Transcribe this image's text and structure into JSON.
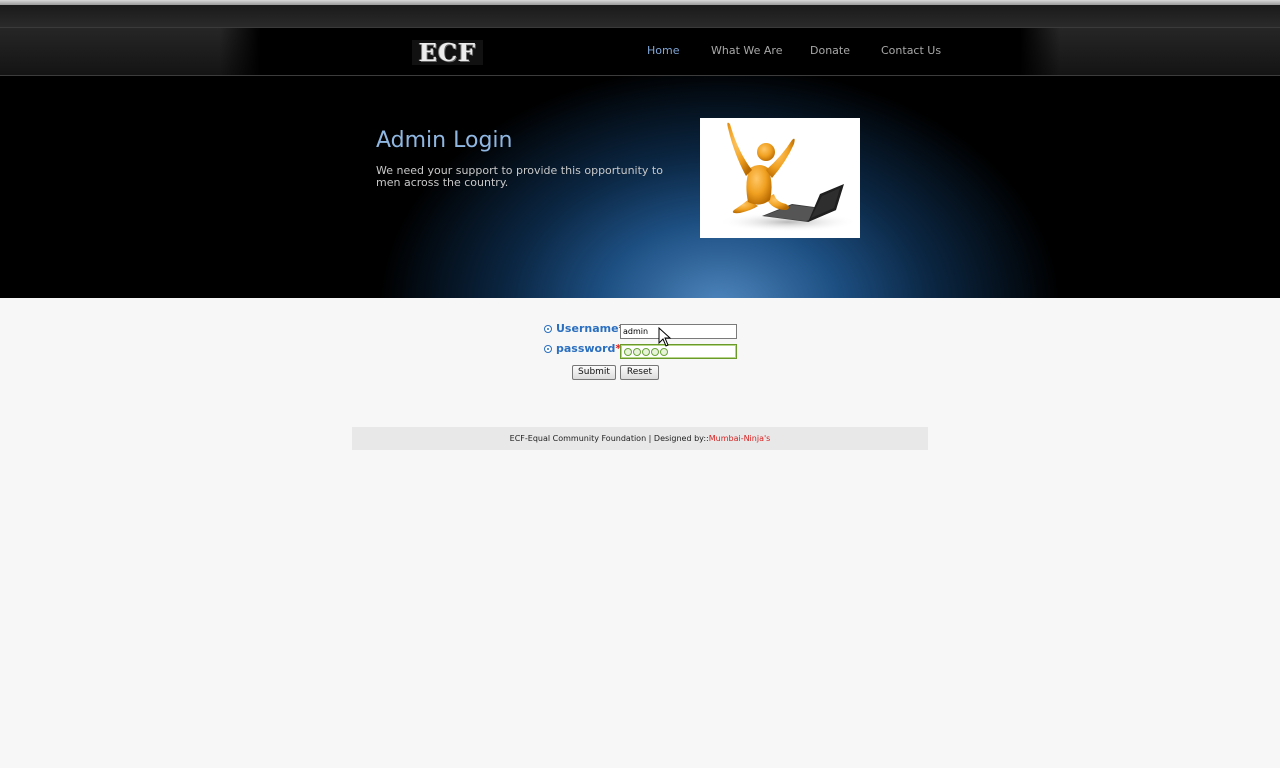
{
  "logo": {
    "text": "ECF"
  },
  "nav": {
    "items": [
      {
        "label": "Home",
        "active": true
      },
      {
        "label": "What We Are",
        "active": false
      },
      {
        "label": "Donate",
        "active": false
      },
      {
        "label": "Contact Us",
        "active": false
      }
    ]
  },
  "hero": {
    "title": "Admin Login",
    "description": "We need your support to provide this opportunity to men across the country.",
    "image_icon": "celebrating-person-with-laptop-icon"
  },
  "form": {
    "username_label": "Username",
    "password_label": "password",
    "required_marker": "*",
    "username_value": "admin",
    "password_mask_count": 5,
    "submit_label": "Submit",
    "reset_label": "Reset"
  },
  "footer": {
    "text": "ECF-Equal Community Foundation | Designed by::",
    "link_text": "Mumbai-Ninja's"
  },
  "colors": {
    "nav_active": "#7fa6d6",
    "hero_title": "#8fb7e2",
    "form_label": "#2a6fc0",
    "required": "#e02020",
    "footer_link": "#d82020"
  }
}
